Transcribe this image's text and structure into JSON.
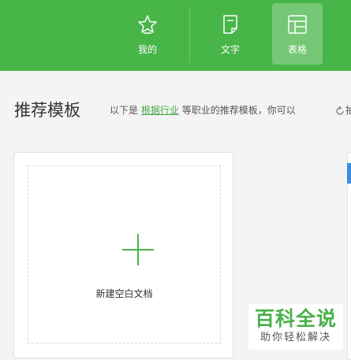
{
  "header": {
    "tabs": [
      {
        "label": "我的",
        "icon": "star-icon"
      },
      {
        "label": "文字",
        "icon": "document-icon"
      },
      {
        "label": "表格",
        "icon": "table-icon",
        "active": true
      }
    ]
  },
  "section": {
    "title": "推荐模板",
    "desc_prefix": "以下是",
    "desc_link": "根据行业",
    "desc_suffix": "等职业的推荐模板，你可以",
    "desc_tail": "抽"
  },
  "card": {
    "new_label": "新建空白文档"
  },
  "watermark": {
    "main": "百科全说",
    "sub": "助你轻松解决"
  },
  "colors": {
    "brand_green": "#48b549",
    "link_green": "#46a84a",
    "accent_blue": "#3a8de0"
  }
}
